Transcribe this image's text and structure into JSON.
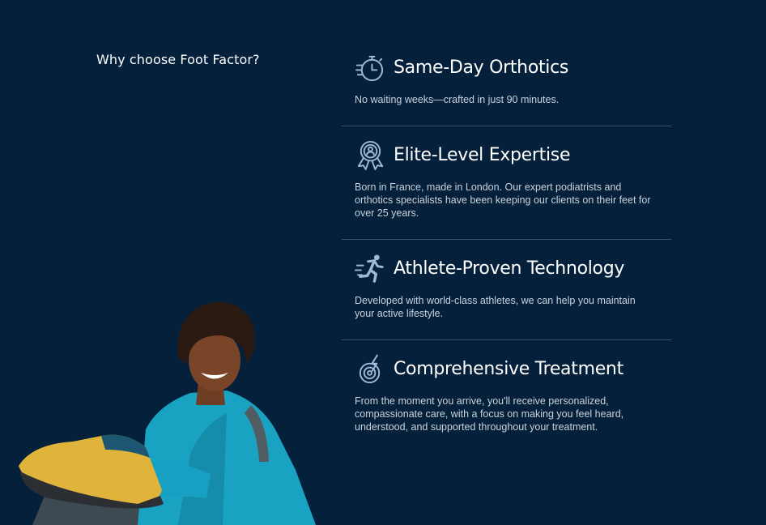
{
  "section": {
    "heading": "Why choose Foot Factor?"
  },
  "features": [
    {
      "icon": "stopwatch-icon",
      "title": "Same-Day Orthotics",
      "description": "No waiting weeks—crafted in just 90 minutes."
    },
    {
      "icon": "award-badge-icon",
      "title": "Elite-Level Expertise",
      "description": "Born in France, made in London.  Our expert podiatrists and orthotics specialists have been keeping our clients on their feet for over 25 years."
    },
    {
      "icon": "running-person-icon",
      "title": "Athlete-Proven Technology",
      "description": "Developed with world-class athletes, we can help you maintain your active lifestyle."
    },
    {
      "icon": "target-bolt-icon",
      "title": "Comprehensive Treatment",
      "description": "From the moment you arrive, you'll receive personalized, compassionate care, with a focus on making you feel heard, understood, and supported throughout your treatment."
    }
  ],
  "colors": {
    "background": "#04203a",
    "icon": "#9fb8d8",
    "divider": "rgba(255,255,255,0.22)"
  }
}
